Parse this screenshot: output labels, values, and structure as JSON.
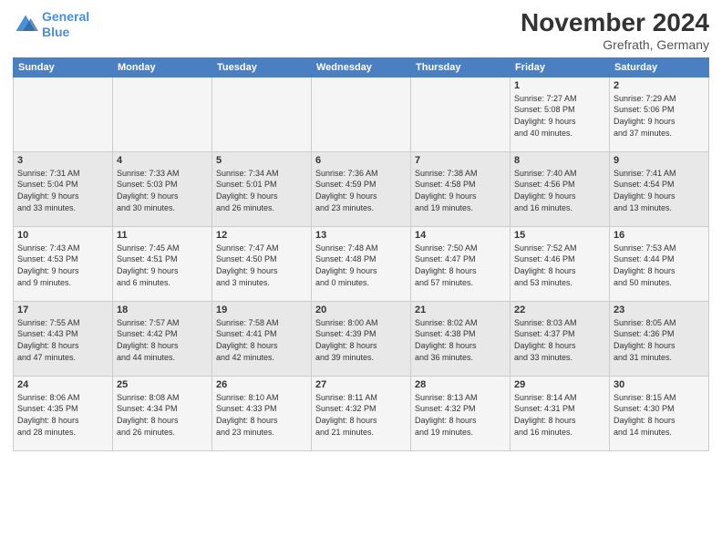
{
  "logo": {
    "line1": "General",
    "line2": "Blue"
  },
  "title": "November 2024",
  "subtitle": "Grefrath, Germany",
  "days_of_week": [
    "Sunday",
    "Monday",
    "Tuesday",
    "Wednesday",
    "Thursday",
    "Friday",
    "Saturday"
  ],
  "weeks": [
    [
      {
        "day": "",
        "info": ""
      },
      {
        "day": "",
        "info": ""
      },
      {
        "day": "",
        "info": ""
      },
      {
        "day": "",
        "info": ""
      },
      {
        "day": "",
        "info": ""
      },
      {
        "day": "1",
        "info": "Sunrise: 7:27 AM\nSunset: 5:08 PM\nDaylight: 9 hours\nand 40 minutes."
      },
      {
        "day": "2",
        "info": "Sunrise: 7:29 AM\nSunset: 5:06 PM\nDaylight: 9 hours\nand 37 minutes."
      }
    ],
    [
      {
        "day": "3",
        "info": "Sunrise: 7:31 AM\nSunset: 5:04 PM\nDaylight: 9 hours\nand 33 minutes."
      },
      {
        "day": "4",
        "info": "Sunrise: 7:33 AM\nSunset: 5:03 PM\nDaylight: 9 hours\nand 30 minutes."
      },
      {
        "day": "5",
        "info": "Sunrise: 7:34 AM\nSunset: 5:01 PM\nDaylight: 9 hours\nand 26 minutes."
      },
      {
        "day": "6",
        "info": "Sunrise: 7:36 AM\nSunset: 4:59 PM\nDaylight: 9 hours\nand 23 minutes."
      },
      {
        "day": "7",
        "info": "Sunrise: 7:38 AM\nSunset: 4:58 PM\nDaylight: 9 hours\nand 19 minutes."
      },
      {
        "day": "8",
        "info": "Sunrise: 7:40 AM\nSunset: 4:56 PM\nDaylight: 9 hours\nand 16 minutes."
      },
      {
        "day": "9",
        "info": "Sunrise: 7:41 AM\nSunset: 4:54 PM\nDaylight: 9 hours\nand 13 minutes."
      }
    ],
    [
      {
        "day": "10",
        "info": "Sunrise: 7:43 AM\nSunset: 4:53 PM\nDaylight: 9 hours\nand 9 minutes."
      },
      {
        "day": "11",
        "info": "Sunrise: 7:45 AM\nSunset: 4:51 PM\nDaylight: 9 hours\nand 6 minutes."
      },
      {
        "day": "12",
        "info": "Sunrise: 7:47 AM\nSunset: 4:50 PM\nDaylight: 9 hours\nand 3 minutes."
      },
      {
        "day": "13",
        "info": "Sunrise: 7:48 AM\nSunset: 4:48 PM\nDaylight: 9 hours\nand 0 minutes."
      },
      {
        "day": "14",
        "info": "Sunrise: 7:50 AM\nSunset: 4:47 PM\nDaylight: 8 hours\nand 57 minutes."
      },
      {
        "day": "15",
        "info": "Sunrise: 7:52 AM\nSunset: 4:46 PM\nDaylight: 8 hours\nand 53 minutes."
      },
      {
        "day": "16",
        "info": "Sunrise: 7:53 AM\nSunset: 4:44 PM\nDaylight: 8 hours\nand 50 minutes."
      }
    ],
    [
      {
        "day": "17",
        "info": "Sunrise: 7:55 AM\nSunset: 4:43 PM\nDaylight: 8 hours\nand 47 minutes."
      },
      {
        "day": "18",
        "info": "Sunrise: 7:57 AM\nSunset: 4:42 PM\nDaylight: 8 hours\nand 44 minutes."
      },
      {
        "day": "19",
        "info": "Sunrise: 7:58 AM\nSunset: 4:41 PM\nDaylight: 8 hours\nand 42 minutes."
      },
      {
        "day": "20",
        "info": "Sunrise: 8:00 AM\nSunset: 4:39 PM\nDaylight: 8 hours\nand 39 minutes."
      },
      {
        "day": "21",
        "info": "Sunrise: 8:02 AM\nSunset: 4:38 PM\nDaylight: 8 hours\nand 36 minutes."
      },
      {
        "day": "22",
        "info": "Sunrise: 8:03 AM\nSunset: 4:37 PM\nDaylight: 8 hours\nand 33 minutes."
      },
      {
        "day": "23",
        "info": "Sunrise: 8:05 AM\nSunset: 4:36 PM\nDaylight: 8 hours\nand 31 minutes."
      }
    ],
    [
      {
        "day": "24",
        "info": "Sunrise: 8:06 AM\nSunset: 4:35 PM\nDaylight: 8 hours\nand 28 minutes."
      },
      {
        "day": "25",
        "info": "Sunrise: 8:08 AM\nSunset: 4:34 PM\nDaylight: 8 hours\nand 26 minutes."
      },
      {
        "day": "26",
        "info": "Sunrise: 8:10 AM\nSunset: 4:33 PM\nDaylight: 8 hours\nand 23 minutes."
      },
      {
        "day": "27",
        "info": "Sunrise: 8:11 AM\nSunset: 4:32 PM\nDaylight: 8 hours\nand 21 minutes."
      },
      {
        "day": "28",
        "info": "Sunrise: 8:13 AM\nSunset: 4:32 PM\nDaylight: 8 hours\nand 19 minutes."
      },
      {
        "day": "29",
        "info": "Sunrise: 8:14 AM\nSunset: 4:31 PM\nDaylight: 8 hours\nand 16 minutes."
      },
      {
        "day": "30",
        "info": "Sunrise: 8:15 AM\nSunset: 4:30 PM\nDaylight: 8 hours\nand 14 minutes."
      }
    ]
  ]
}
